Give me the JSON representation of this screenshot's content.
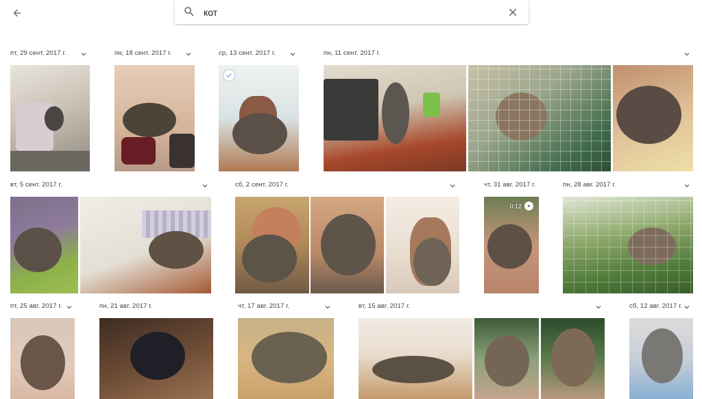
{
  "header": {
    "back_icon": "arrow-back-icon",
    "search_icon": "search-icon",
    "search_value": "кот",
    "clear_icon": "close-icon"
  },
  "groups": [
    {
      "date": "пт, 29 сент. 2017 г."
    },
    {
      "date": "пн, 18 сент. 2017 г."
    },
    {
      "date": "ср, 13 сент. 2017 г."
    },
    {
      "date": "пн, 11 сент. 2017 г."
    },
    {
      "date": "вт, 5 сент. 2017 г."
    },
    {
      "date": "сб, 2 сент. 2017 г."
    },
    {
      "date": "чт, 31 авг. 2017 г."
    },
    {
      "date": "пн, 28 авг. 2017 г."
    },
    {
      "date": "пт, 25 авг. 2017 г."
    },
    {
      "date": "пн, 21 авг. 2017 г."
    },
    {
      "date": "чт, 17 авг. 2017 г."
    },
    {
      "date": "вт, 15 авг. 2017 г."
    },
    {
      "date": "сб, 12 авг. 2017 г."
    }
  ],
  "video": {
    "duration": "0:12",
    "icon": "play-icon"
  },
  "selected_icon": "check-circle-icon",
  "colors": {
    "accent": "#1a73e8",
    "text": "#3c4043",
    "icon": "#5f6368"
  }
}
